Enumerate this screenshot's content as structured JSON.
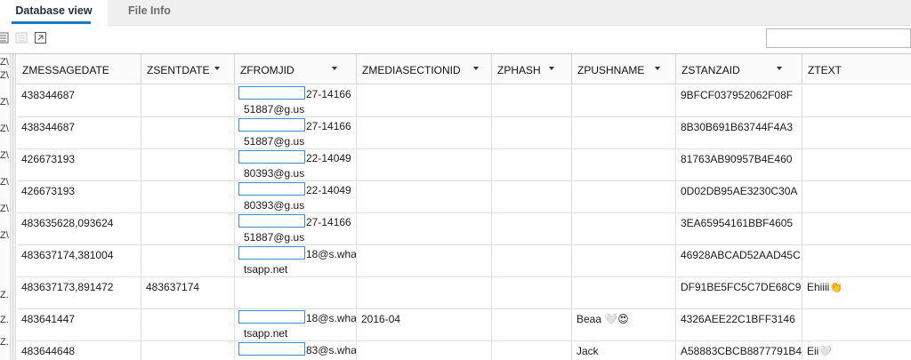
{
  "tabs": [
    {
      "label": "Database view",
      "active": true
    },
    {
      "label": "File Info",
      "active": false
    }
  ],
  "toolbar": {
    "icons": [
      "list-view-icon",
      "disabled-list-icon",
      "export-icon"
    ],
    "search_placeholder": ""
  },
  "left_labels": [
    "Z\\",
    "Z\\",
    "Z\\",
    "Z\\",
    "Z\\",
    "Z\\",
    "Z\\",
    "Z\\",
    "Z.",
    "Z.",
    "Z."
  ],
  "table": {
    "columns": [
      {
        "label": "ZMESSAGEDATE",
        "sortable": false
      },
      {
        "label": "ZSENTDATE",
        "sortable": true
      },
      {
        "label": "ZFROMJID",
        "sortable": true
      },
      {
        "label": "ZMEDIASECTIONID",
        "sortable": true
      },
      {
        "label": "ZPHASH",
        "sortable": true
      },
      {
        "label": "ZPUSHNAME",
        "sortable": true
      },
      {
        "label": "ZSTANZAID",
        "sortable": true
      },
      {
        "label": "ZTEXT",
        "sortable": false
      }
    ],
    "rows": [
      {
        "msgdate": "438344687",
        "sentdate": "",
        "jid1": "27-14166",
        "jid2": "51887@g.us",
        "media": "",
        "phash": "",
        "push": "",
        "stanza": "9BFCF037952062F08F",
        "text": ""
      },
      {
        "msgdate": "438344687",
        "sentdate": "",
        "jid1": "27-14166",
        "jid2": "51887@g.us",
        "media": "",
        "phash": "",
        "push": "",
        "stanza": "8B30B691B63744F4A3",
        "text": ""
      },
      {
        "msgdate": "426673193",
        "sentdate": "",
        "jid1": "22-14049",
        "jid2": "80393@g.us",
        "media": "",
        "phash": "",
        "push": "",
        "stanza": "81763AB90957B4E460",
        "text": ""
      },
      {
        "msgdate": "426673193",
        "sentdate": "",
        "jid1": "22-14049",
        "jid2": "80393@g.us",
        "media": "",
        "phash": "",
        "push": "",
        "stanza": "0D02DB95AE3230C30A",
        "text": ""
      },
      {
        "msgdate": "483635628,093624",
        "sentdate": "",
        "jid1": "27-14166",
        "jid2": "51887@g.us",
        "media": "",
        "phash": "",
        "push": "",
        "stanza": "3EA65954161BBF4605",
        "text": ""
      },
      {
        "msgdate": "483637174,381004",
        "sentdate": "",
        "jid1": "18@s.wha",
        "jid2": "tsapp.net",
        "media": "",
        "phash": "",
        "push": "",
        "stanza": "46928ABCAD52AAD45C",
        "text": ""
      },
      {
        "msgdate": "483637173,891472",
        "sentdate": "483637174",
        "jid1": "",
        "jid2": "",
        "media": "",
        "phash": "",
        "push": "",
        "stanza": "DF91BE5FC5C7DE68C9",
        "text": "Ehiiii👏"
      },
      {
        "msgdate": "483641447",
        "sentdate": "",
        "jid1": "18@s.wha",
        "jid2": "tsapp.net",
        "media": "2016-04",
        "phash": "",
        "push": "Beaa 🤍😍",
        "stanza": "4326AEE22C1BFF3146",
        "text": ""
      },
      {
        "msgdate": "483644648",
        "sentdate": "",
        "jid1": "83@s.wha",
        "jid2": "",
        "media": "",
        "phash": "",
        "push": "Jack",
        "stanza": "A58883CBCB8877791B4",
        "text": "Eii🤍"
      }
    ]
  }
}
